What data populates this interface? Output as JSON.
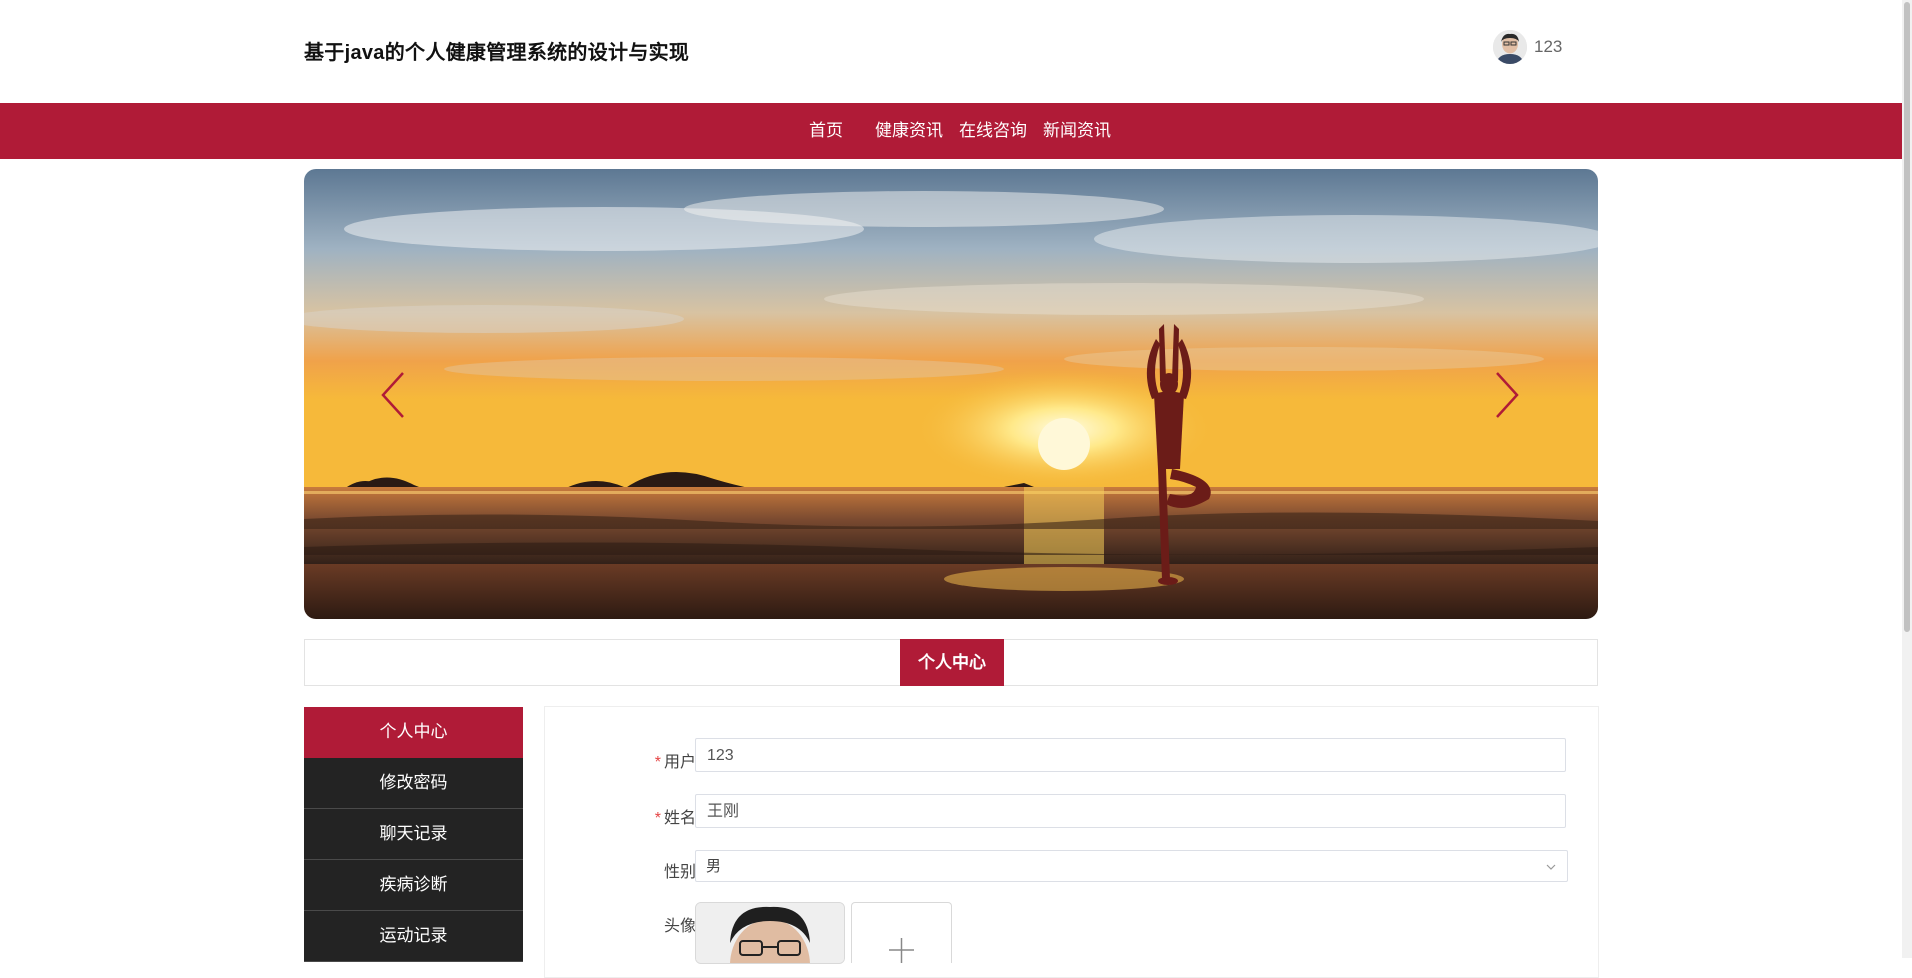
{
  "header": {
    "title": "基于java的个人健康管理系统的设计与实现",
    "username": "123",
    "avatar_icon": "user-avatar"
  },
  "nav": {
    "items": [
      {
        "label": "首页"
      },
      {
        "label": "健康资讯"
      },
      {
        "label": "在线咨询"
      },
      {
        "label": "新闻资讯"
      }
    ],
    "color": "#b01b37"
  },
  "banner": {
    "left_arrow_icon": "chevron-left-icon",
    "right_arrow_icon": "chevron-right-icon",
    "arrow_color": "#b01b37"
  },
  "section": {
    "title": "个人中心"
  },
  "sidebar": {
    "items": [
      {
        "label": "个人中心",
        "active": true
      },
      {
        "label": "修改密码"
      },
      {
        "label": "聊天记录"
      },
      {
        "label": "疾病诊断"
      },
      {
        "label": "运动记录"
      }
    ],
    "bg": "#232323",
    "active_bg": "#b01b37"
  },
  "form": {
    "fields": [
      {
        "label": "用户",
        "required": true,
        "value": "123"
      },
      {
        "label": "姓名",
        "required": true,
        "value": "王刚"
      },
      {
        "label": "性别",
        "required": false,
        "value": "男"
      },
      {
        "label": "头像",
        "required": false
      }
    ],
    "required_mark": "*",
    "upload_icon": "plus-icon"
  }
}
